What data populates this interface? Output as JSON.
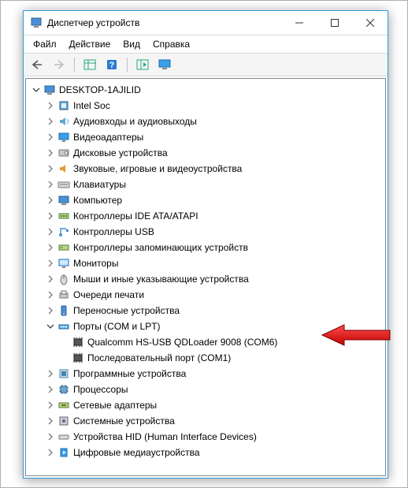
{
  "window": {
    "title": "Диспетчер устройств"
  },
  "menu": {
    "file": "Файл",
    "action": "Действие",
    "view": "Вид",
    "help": "Справка"
  },
  "tree": {
    "root": "DESKTOP-1AJILID",
    "items": [
      {
        "label": "Intel Soc",
        "icon": "cpu"
      },
      {
        "label": "Аудиовходы и аудиовыходы",
        "icon": "audio"
      },
      {
        "label": "Видеоадаптеры",
        "icon": "display"
      },
      {
        "label": "Дисковые устройства",
        "icon": "disk"
      },
      {
        "label": "Звуковые, игровые и видеоустройства",
        "icon": "sound"
      },
      {
        "label": "Клавиатуры",
        "icon": "keyboard"
      },
      {
        "label": "Компьютер",
        "icon": "computer"
      },
      {
        "label": "Контроллеры IDE ATA/ATAPI",
        "icon": "ide"
      },
      {
        "label": "Контроллеры USB",
        "icon": "usb"
      },
      {
        "label": "Контроллеры запоминающих устройств",
        "icon": "storage"
      },
      {
        "label": "Мониторы",
        "icon": "monitor"
      },
      {
        "label": "Мыши и иные указывающие устройства",
        "icon": "mouse"
      },
      {
        "label": "Очереди печати",
        "icon": "printer"
      },
      {
        "label": "Переносные устройства",
        "icon": "portable"
      },
      {
        "label": "Порты (COM и LPT)",
        "icon": "port",
        "expanded": true,
        "children": [
          {
            "label": "Qualcomm HS-USB QDLoader 9008 (COM6)",
            "icon": "port-dev",
            "highlighted": true
          },
          {
            "label": "Последовательный порт (COM1)",
            "icon": "port-dev"
          }
        ]
      },
      {
        "label": "Программные устройства",
        "icon": "software"
      },
      {
        "label": "Процессоры",
        "icon": "processor"
      },
      {
        "label": "Сетевые адаптеры",
        "icon": "network"
      },
      {
        "label": "Системные устройства",
        "icon": "system"
      },
      {
        "label": "Устройства HID (Human Interface Devices)",
        "icon": "hid"
      },
      {
        "label": "Цифровые медиаустройства",
        "icon": "media"
      }
    ]
  }
}
